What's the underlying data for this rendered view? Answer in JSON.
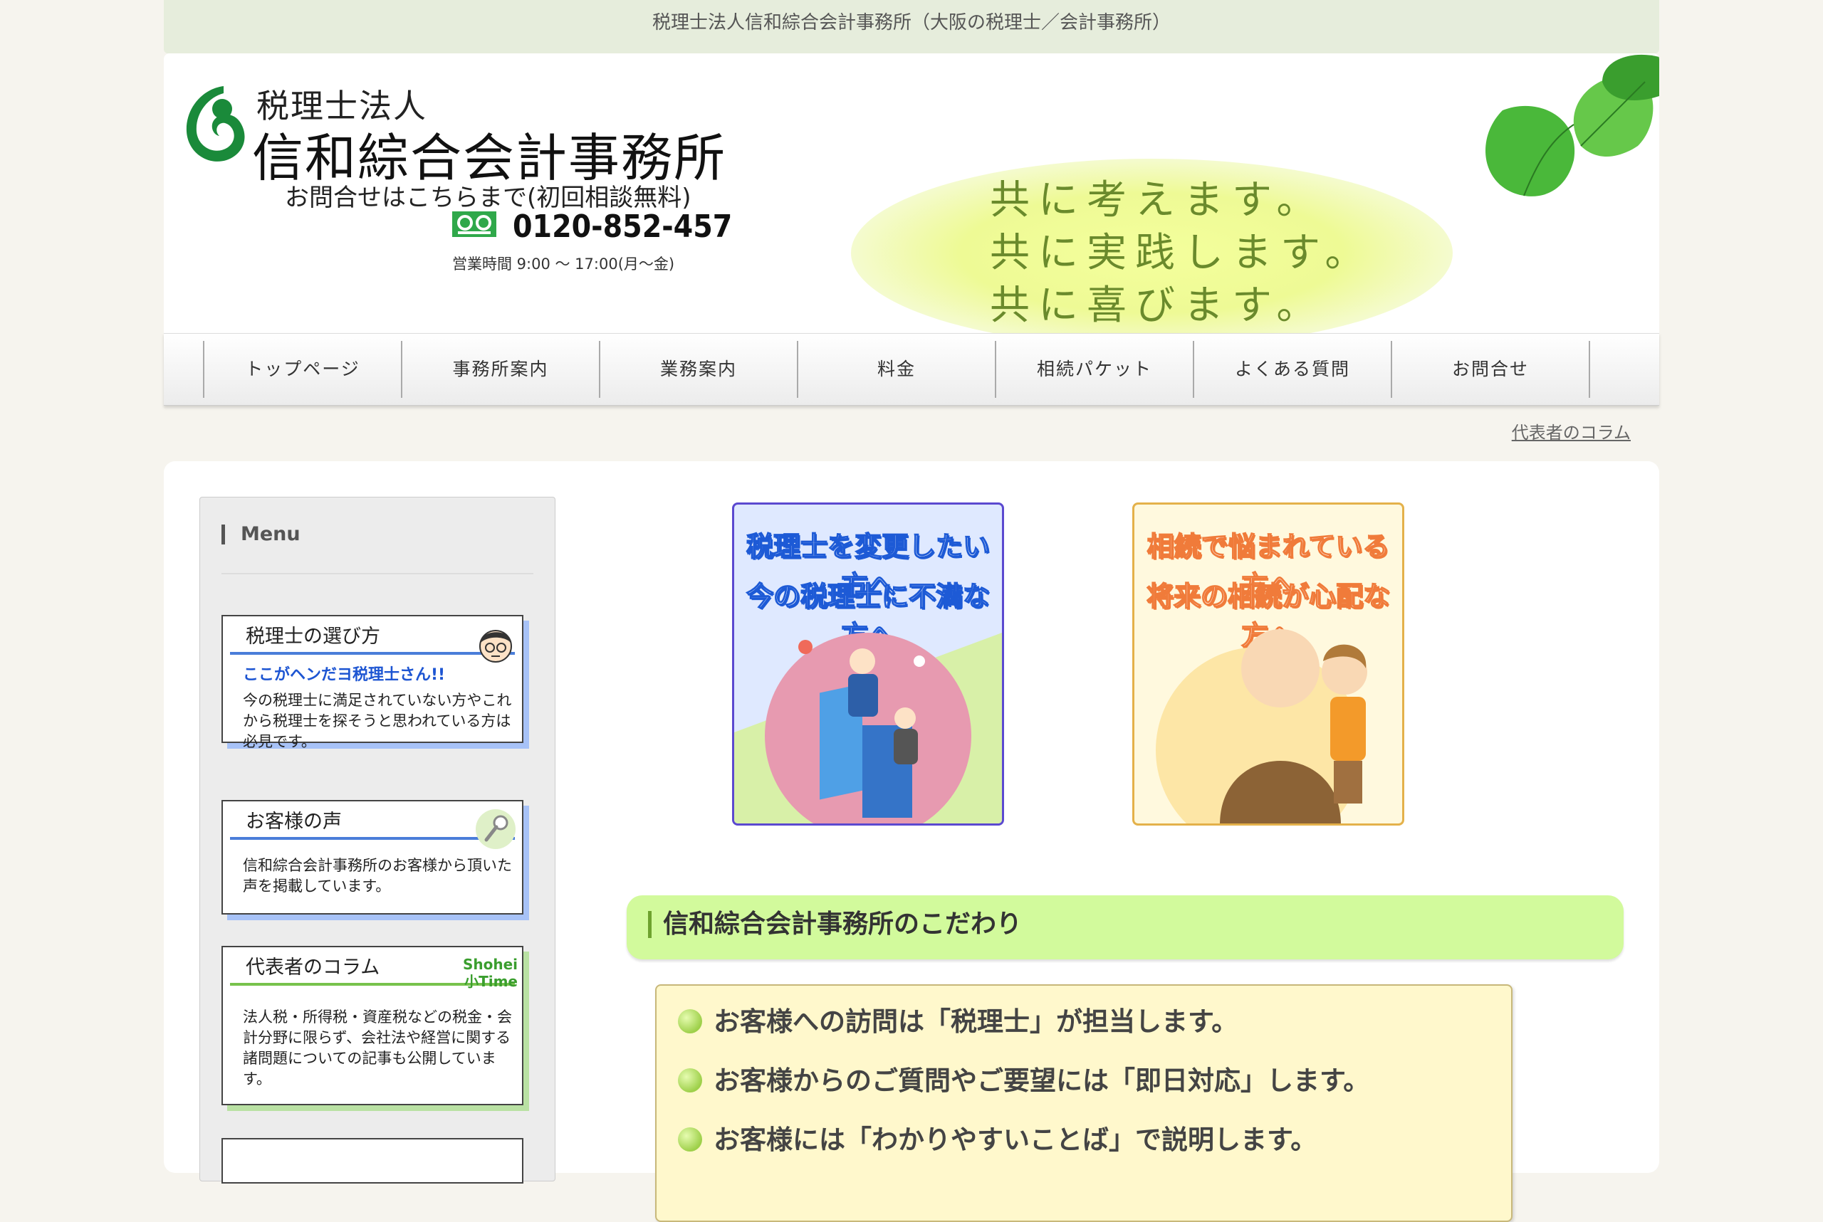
{
  "site": {
    "top_title": "税理士法人信和綜合会計事務所（大阪の税理士／会計事務所）",
    "firm_type": "税理士法人",
    "firm_name": "信和綜合会計事務所",
    "contact_label": "お問合せはこちらまで(初回相談無料)",
    "phone": "0120-852-457",
    "hours": "営業時間 9:00 〜 17:00(月〜金)",
    "slogan": [
      "共に考えます。",
      "共に実践します。",
      "共に喜びます。"
    ]
  },
  "nav": {
    "items": [
      {
        "label": "トップページ"
      },
      {
        "label": "事務所案内"
      },
      {
        "label": "業務案内"
      },
      {
        "label": "料金"
      },
      {
        "label": "相続パケット"
      },
      {
        "label": "よくある質問"
      },
      {
        "label": "お問合せ"
      }
    ],
    "sub_link": "代表者のコラム"
  },
  "sidebar": {
    "title": "Menu",
    "banners": [
      {
        "title": "税理士の選び方",
        "catch": "ここがヘンだヨ税理士さん!!",
        "text": "今の税理士に満足されていない方やこれから税理士を探そうと思われている方は必見です。"
      },
      {
        "title": "お客様の声",
        "text": "信和綜合会計事務所のお客様から頂いた声を掲載しています。"
      },
      {
        "title": "代表者のコラム",
        "badge1": "Shohei",
        "badge2": "小Time",
        "text": "法人税・所得税・資産税などの税金・会計分野に限らず、会社法や経営に関する諸問題についての記事も公開しています。"
      }
    ]
  },
  "promos": {
    "tax": [
      "税理士を変更したい方へ",
      "今の税理士に不満な方へ"
    ],
    "inheritance": [
      "相続で悩まれている方へ",
      "将来の相続が心配な方へ"
    ]
  },
  "section": {
    "title": "信和綜合会計事務所のこだわり",
    "points": [
      "お客様への訪問は「税理士」が担当します。",
      "お客様からのご質問やご要望には「即日対応」します。",
      "お客様には「わかりやすいことば」で説明します。"
    ]
  }
}
